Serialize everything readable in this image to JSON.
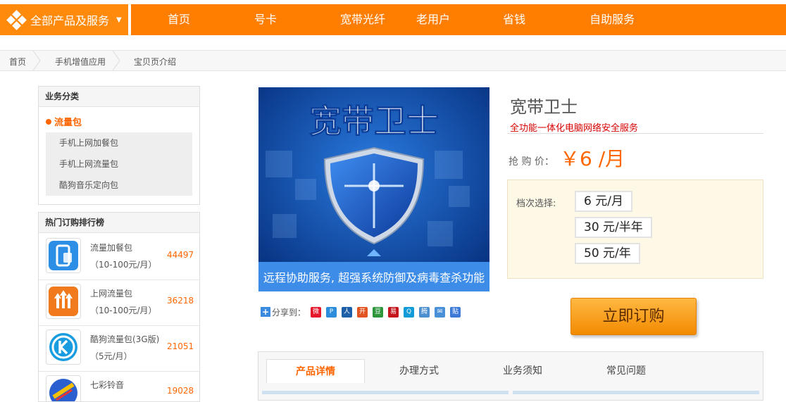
{
  "header": {
    "all_products": "全部产品及服务",
    "nav": [
      "首页",
      "号卡",
      "宽带光纤",
      "老用户",
      "省钱",
      "自助服务"
    ]
  },
  "breadcrumb": [
    "首页",
    "手机增值应用",
    "宝贝页介绍"
  ],
  "sidebar": {
    "category_title": "业务分类",
    "active_category": "流量包",
    "subcategories": [
      "手机上网加餐包",
      "手机上网流量包",
      "酷狗音乐定向包"
    ],
    "ranking_title": "热门订购排行榜",
    "ranking": [
      {
        "name": "流量加餐包",
        "price": "（10-100元/月）",
        "count": "44497",
        "icon": "phone-icon"
      },
      {
        "name": "上网流量包",
        "price": "（10-100元/月）",
        "count": "36218",
        "icon": "upload-arrows-icon"
      },
      {
        "name": "酷狗流量包(3G版)",
        "price": "（5元/月）",
        "count": "21051",
        "icon": "kugou-k-icon"
      },
      {
        "name": "七彩铃音",
        "price": "",
        "count": "19028",
        "icon": "music-note-icon"
      }
    ]
  },
  "product": {
    "image_title": "宽带卫士",
    "image_caption": "远程协助服务, 超强系统防御及病毒查杀功能",
    "title": "宽带卫士",
    "subtitle": "全功能一体化电脑网络安全服务",
    "price_label": "抢 购 价：",
    "price": "￥6 /月",
    "tier_label": "档次选择:",
    "tiers": [
      "6 元/月",
      "30 元/半年",
      "50 元/年"
    ],
    "buy_button": "立即订购",
    "share_label": "分享到："
  },
  "share_icons": [
    {
      "name": "weibo-icon",
      "color": "#e6162d",
      "glyph": "微"
    },
    {
      "name": "qzone-icon",
      "color": "#2b8ddc",
      "glyph": "P"
    },
    {
      "name": "renren-icon",
      "color": "#1c5fa8",
      "glyph": "人"
    },
    {
      "name": "kaixin-icon",
      "color": "#e25522",
      "glyph": "开"
    },
    {
      "name": "douban-icon",
      "color": "#2d963d",
      "glyph": "豆"
    },
    {
      "name": "netease-icon",
      "color": "#c4161c",
      "glyph": "易"
    },
    {
      "name": "qq-friend-icon",
      "color": "#0f9ad8",
      "glyph": "Q"
    },
    {
      "name": "tencent-weibo-icon",
      "color": "#4c8fcf",
      "glyph": "腾"
    },
    {
      "name": "email-icon",
      "color": "#4a90d8",
      "glyph": "✉"
    },
    {
      "name": "tieba-icon",
      "color": "#3d7ad8",
      "glyph": "贴"
    }
  ],
  "tabs": [
    "产品详情",
    "办理方式",
    "业务须知",
    "常见问题"
  ]
}
